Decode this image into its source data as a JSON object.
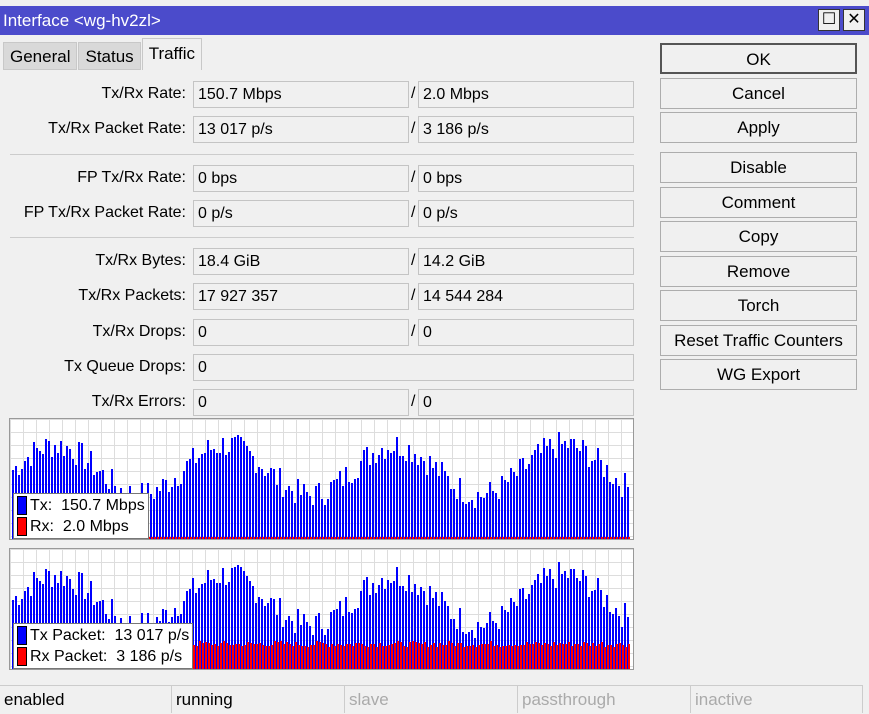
{
  "window": {
    "title": "Interface <wg-hv2zl>",
    "maximize": "☐",
    "close": "✕"
  },
  "tabs": [
    "General",
    "Status",
    "Traffic"
  ],
  "fields": {
    "txrx_rate": {
      "label": "Tx/Rx Rate:",
      "tx": "150.7 Mbps",
      "rx": "2.0 Mbps"
    },
    "txrx_packet_rate": {
      "label": "Tx/Rx Packet Rate:",
      "tx": "13 017 p/s",
      "rx": "3 186 p/s"
    },
    "fp_txrx_rate": {
      "label": "FP Tx/Rx Rate:",
      "tx": "0 bps",
      "rx": "0 bps"
    },
    "fp_txrx_packet_rate": {
      "label": "FP Tx/Rx Packet Rate:",
      "tx": "0 p/s",
      "rx": "0 p/s"
    },
    "txrx_bytes": {
      "label": "Tx/Rx Bytes:",
      "tx": "18.4 GiB",
      "rx": "14.2 GiB"
    },
    "txrx_packets": {
      "label": "Tx/Rx Packets:",
      "tx": "17 927 357",
      "rx": "14 544 284"
    },
    "txrx_drops": {
      "label": "Tx/Rx Drops:",
      "tx": "0",
      "rx": "0"
    },
    "tx_queue_drops": {
      "label": "Tx Queue Drops:",
      "value": "0"
    },
    "txrx_errors": {
      "label": "Tx/Rx Errors:",
      "tx": "0",
      "rx": "0"
    },
    "slash": "/"
  },
  "buttons": [
    "OK",
    "Cancel",
    "Apply",
    "Disable",
    "Comment",
    "Copy",
    "Remove",
    "Torch",
    "Reset Traffic Counters",
    "WG Export"
  ],
  "graphs": {
    "rate": {
      "tx_label": "Tx:  150.7 Mbps",
      "rx_label": "Rx:  2.0 Mbps"
    },
    "packet": {
      "tx_label": "Tx Packet:  13 017 p/s",
      "rx_label": "Rx Packet:  3 186 p/s"
    },
    "colors": {
      "tx": "#0000ff",
      "rx": "#ff0000"
    }
  },
  "status": [
    "enabled",
    "running",
    "slave",
    "passthrough",
    "inactive"
  ]
}
